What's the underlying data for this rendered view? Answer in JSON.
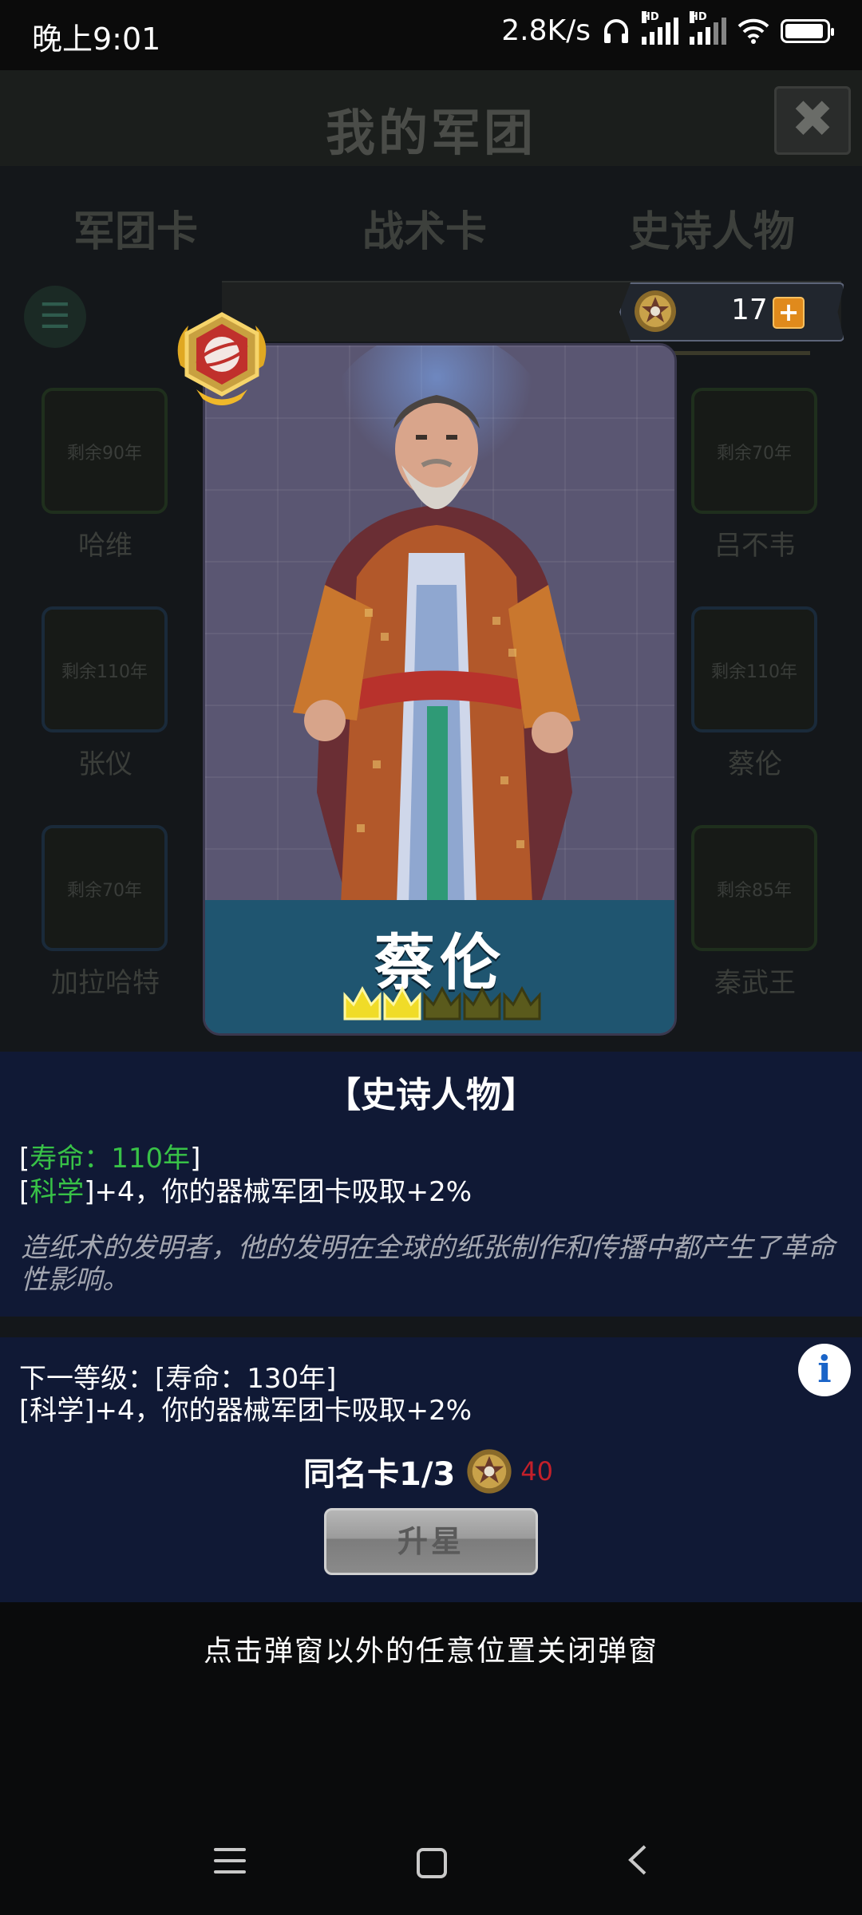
{
  "status_bar": {
    "time": "晚上9:01",
    "network_speed": "2.8K/s",
    "hd_label": "HD"
  },
  "background": {
    "title": "我的军团",
    "close_glyph": "✖",
    "tabs": [
      "军团卡",
      "战术卡",
      "史诗人物"
    ],
    "cards": [
      {
        "remaining": "剩余90年",
        "name": "哈维"
      },
      {
        "remaining": "剩余70年",
        "name": "吕不韦"
      },
      {
        "remaining": "剩余110年",
        "name": "张仪"
      },
      {
        "remaining": "剩余110年",
        "name": "蔡伦"
      },
      {
        "remaining": "剩余70年",
        "name": "加拉哈特"
      },
      {
        "remaining": "剩余85年",
        "name": "秦武王"
      }
    ]
  },
  "currency": {
    "count": "17",
    "plus": "+"
  },
  "card": {
    "name": "蔡伦",
    "stars_total": 5,
    "stars_filled": 2
  },
  "details": {
    "rarity": "【史诗人物】",
    "life_bracket_open": "[",
    "life_text": "寿命：110年",
    "life_bracket_close": "]",
    "science_bracket_open": "[",
    "science_label": "科学",
    "science_effect": "]+4，你的器械军团卡吸取+2%",
    "description": "造纸术的发明者，他的发明在全球的纸张制作和传播中都产生了革命性影响。",
    "next_level_line1": "下一等级：[寿命：130年]",
    "next_level_line2": "[科学]+4，你的器械军团卡吸取+2%",
    "info_glyph": "i",
    "duplicate_label": "同名卡1/3",
    "duplicate_cost": "40",
    "upgrade_button": "升星",
    "dismiss_hint": "点击弹窗以外的任意位置关闭弹窗"
  }
}
